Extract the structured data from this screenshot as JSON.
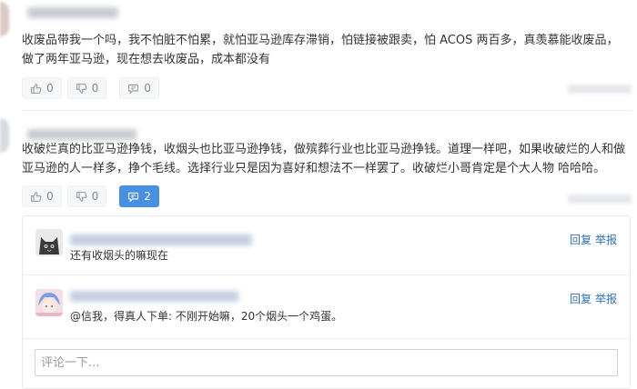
{
  "comments": [
    {
      "text": "收废品带我一个吗，我不怕脏不怕累，就怕亚马逊库存滞销，怕链接被跟卖，怕 ACOS 两百多，真羡慕能收废品，做了两年亚马逊，现在想去收废品，成本都没有",
      "like_count": "0",
      "dislike_count": "0",
      "reply_count": "0"
    },
    {
      "text": "收破烂真的比亚马逊挣钱，收烟头也比亚马逊挣钱，做殡葬行业也比亚马逊挣钱。道理一样吧，如果收破烂的人和做亚马逊的人一样多，挣个毛线。选择行业只是因为喜好和想法不一样罢了。收破烂小哥肯定是个大人物 哈哈哈。",
      "like_count": "0",
      "dislike_count": "0",
      "reply_count": "2"
    }
  ],
  "replies": [
    {
      "text": "还有收烟头的嘛现在",
      "reply_label": "回复",
      "report_label": "举报"
    },
    {
      "text": "@信我，得真人下单: 不刚开始嘛，20个烟头一个鸡蛋。",
      "reply_label": "回复",
      "report_label": "举报"
    }
  ],
  "comment_input": {
    "placeholder": "评论一下..."
  },
  "icons": {
    "like": "thumbs-up-icon",
    "dislike": "thumbs-down-icon",
    "reply": "speech-bubble-icon"
  },
  "colors": {
    "accent": "#4a90e2",
    "link": "#2f6fb3"
  }
}
